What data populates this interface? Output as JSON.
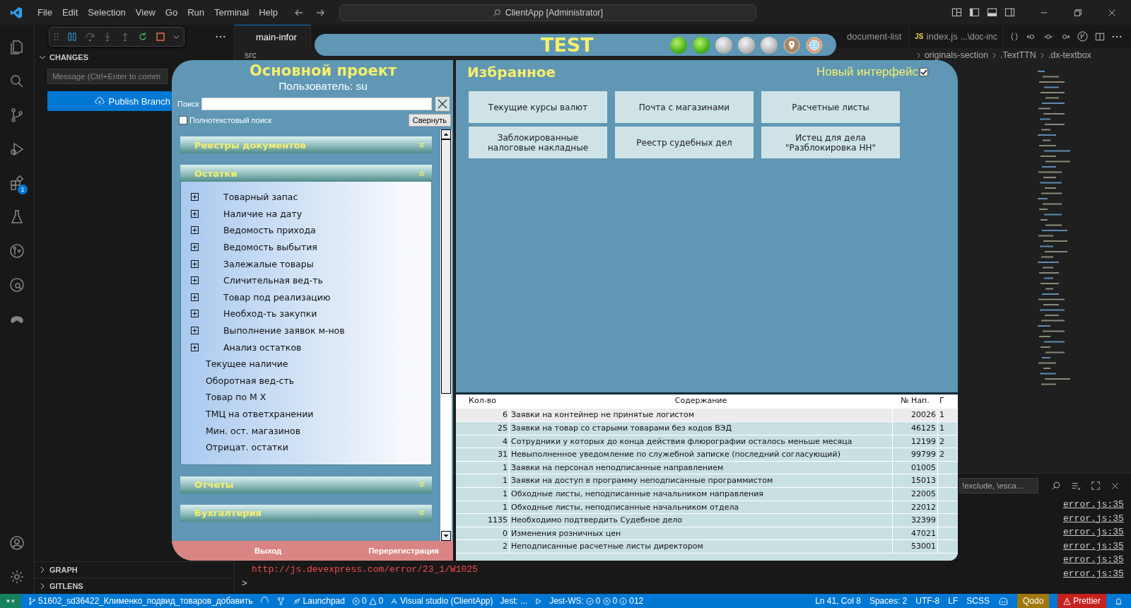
{
  "vscode": {
    "menu": [
      "File",
      "Edit",
      "Selection",
      "View",
      "Go",
      "Run",
      "Terminal",
      "Help"
    ],
    "command_center": "ClientApp [Administrator]",
    "extensions_badge": "1",
    "sidebar": {
      "section": "CHANGES",
      "message_placeholder": "Message (Ctrl+Enter to comm",
      "publish_button": "Publish Branch",
      "bottom_sections": [
        "GRAPH",
        "GITLENS"
      ]
    },
    "tabs": [
      {
        "label": "main-infor",
        "selected": true
      },
      {
        "label": "document-list",
        "selected": false
      },
      {
        "badge": "JS",
        "label": "index.js",
        "detail": "...\\doc-inc",
        "selected": false
      }
    ],
    "breadcrumb": [
      "src",
      "originals-section",
      ".TextTTN",
      ".dx-textbox"
    ],
    "terminal": {
      "find_placeholder": "!exclude, \\esca...",
      "url_line": "http://js.devexpress.com/error/23_1/W1025",
      "prompt": ">",
      "links": [
        "error.js:35",
        "error.js:35",
        "error.js:35",
        "error.js:35",
        "error.js:35",
        "error.js:35"
      ]
    },
    "status_bar": {
      "branch": "51602_sd36422_Клименко_подвид_товаров_добавить",
      "launchpad": "Launchpad",
      "errors": "0",
      "warnings": "0",
      "project": "Visual studio (ClientApp)",
      "jest": "Jest: ...",
      "jest_ws": "Jest-WS:",
      "jest_counts": [
        "0",
        "0",
        "0"
      ],
      "jest_total": "12",
      "right": [
        "Ln 41, Col 8",
        "Spaces: 2",
        "UTF-8",
        "LF",
        "SCSS"
      ],
      "qodo": "Qodo",
      "prettier": "Prettier"
    }
  },
  "app": {
    "badge": "TEST",
    "indicators": [
      {
        "kind": "lamp",
        "on": true
      },
      {
        "kind": "lamp",
        "on": true
      },
      {
        "kind": "lamp",
        "on": false
      },
      {
        "kind": "lamp",
        "on": false
      },
      {
        "kind": "lamp",
        "on": false
      },
      {
        "kind": "pin"
      },
      {
        "kind": "globe"
      }
    ],
    "left": {
      "title": "Основной проект",
      "user": "Пользователь: su",
      "search_label": "Поиск",
      "fulltext": {
        "label": "Полнотекстовый поиск",
        "checked": false
      },
      "collapse_button": "Свернуть",
      "sections": [
        {
          "title": "Реестры документов",
          "expanded": false
        },
        {
          "title": "Остатки",
          "expanded": true,
          "items": [
            {
              "label": "Товарный запас",
              "kind": "group"
            },
            {
              "label": "Наличие на дату",
              "kind": "group"
            },
            {
              "label": "Ведомость прихода",
              "kind": "group"
            },
            {
              "label": "Ведомость выбытия",
              "kind": "group"
            },
            {
              "label": "Залежалые товары",
              "kind": "group"
            },
            {
              "label": "Сличительная вед-ть",
              "kind": "group"
            },
            {
              "label": "Товар под реализацию",
              "kind": "group"
            },
            {
              "label": "Необход-ть закупки",
              "kind": "group"
            },
            {
              "label": "Выполнение заявок м-нов",
              "kind": "group"
            },
            {
              "label": "Анализ остатков",
              "kind": "group"
            },
            {
              "label": "Текущее наличие",
              "kind": "link"
            },
            {
              "label": "Оборотная вед-сть",
              "kind": "link"
            },
            {
              "label": "Товар по М Х",
              "kind": "link"
            },
            {
              "label": "ТМЦ на ответхранении",
              "kind": "link"
            },
            {
              "label": "Мин. ост. магазинов",
              "kind": "link"
            },
            {
              "label": "Отрицат. остатки",
              "kind": "link"
            }
          ]
        },
        {
          "title": "Отчеты",
          "expanded": false
        },
        {
          "title": "Бухгалтерия",
          "expanded": false
        }
      ],
      "footer": [
        "Выход",
        "Перерегистрация"
      ]
    },
    "right": {
      "title": "Избранное",
      "new_interface": {
        "label": "Новый интерфейс",
        "checked": true
      },
      "favorites": [
        "Текущие курсы валют",
        "Почта с магазинами",
        "Расчетные листы",
        "Заблокированные налоговые накладные",
        "Реестр судебных дел",
        "Истец для дела \"Разблокировка НН\""
      ],
      "table": {
        "columns": [
          "Кол-во",
          "Содержание",
          "№ Нап.",
          "Г"
        ],
        "rows": [
          {
            "cells": [
              "6",
              "Заявки на контейнер не принятые логистом",
              "20026",
              "1"
            ],
            "selected": true
          },
          {
            "cells": [
              "25",
              "Заявки на товар со старыми товарами без кодов ВЭД",
              "46125",
              "1"
            ],
            "selected": false
          },
          {
            "cells": [
              "4",
              "Сотрудники у которых до конца действия флюрографии осталось меньше месяца",
              "12199",
              "2"
            ],
            "selected": false
          },
          {
            "cells": [
              "31",
              "Невыполненное уведомление по служебной записке (последний согласующий)",
              "99799",
              "2"
            ],
            "selected": false
          },
          {
            "cells": [
              "1",
              "Заявки на персонал неподписанные направлением",
              "01005"
            ],
            "selected": false
          },
          {
            "cells": [
              "1",
              "Заявки на доступ в программу неподписанные программистом",
              "15013"
            ],
            "selected": false
          },
          {
            "cells": [
              "1",
              "Обходные листы, неподписанные начальником направления",
              "22005"
            ],
            "selected": false
          },
          {
            "cells": [
              "1",
              "Обходные листы, неподписанные начальником отдела",
              "22012"
            ],
            "selected": false
          },
          {
            "cells": [
              "1135",
              "Необходимо подтвердить Судебное дело",
              "32399"
            ],
            "selected": false
          },
          {
            "cells": [
              "0",
              "Изменения розничных цен",
              "47021"
            ],
            "selected": false
          },
          {
            "cells": [
              "2",
              "Неподписанные расчетные листы директором",
              "53001"
            ],
            "selected": false
          }
        ]
      }
    }
  }
}
